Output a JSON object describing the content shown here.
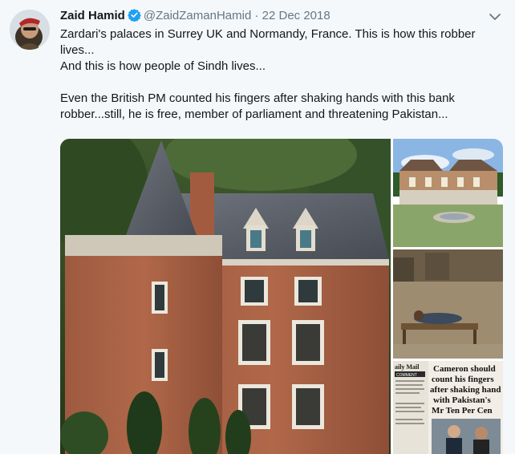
{
  "tweet": {
    "author_name": "Zaid Hamid",
    "handle": "@ZaidZamanHamid",
    "separator": "·",
    "date": "22 Dec 2018",
    "lines": [
      "Zardari's palaces in Surrey UK and Normandy, France. This is how this robber",
      "lives...",
      "And this is how people of Sindh lives...",
      "",
      "Even the British PM counted his fingers after shaking hands with this bank",
      "robber...still, he is free, member of parliament  and threatening Pakistan..."
    ]
  },
  "icons": {
    "avatar": "avatar-photo",
    "verified": "verified-badge-icon",
    "menu": "chevron-down-icon"
  },
  "newspaper": {
    "masthead": "aily Mail",
    "section": "COMMENT",
    "headline_lines": [
      "Cameron should",
      "count his fingers",
      "after shaking hand",
      "with Pakistan's",
      "Mr Ten Per Cen"
    ]
  },
  "colors": {
    "background": "#f5f8fa",
    "text": "#14171a",
    "secondary": "#657786",
    "verified": "#1da1f2"
  }
}
